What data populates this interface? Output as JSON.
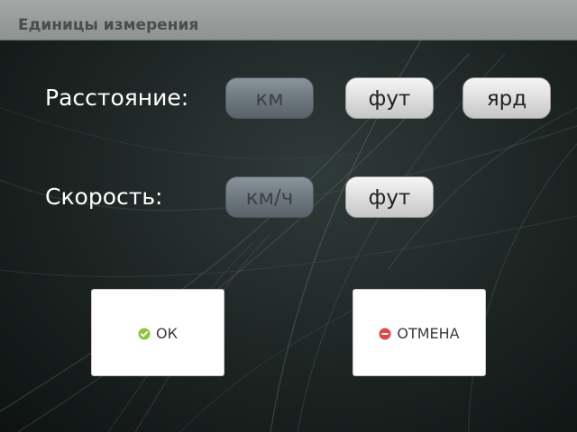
{
  "window": {
    "title": "Единицы измерения"
  },
  "distance": {
    "label": "Расстояние:",
    "options": [
      {
        "label": "км",
        "selected": false
      },
      {
        "label": "фут",
        "selected": true
      },
      {
        "label": "ярд",
        "selected": true
      }
    ]
  },
  "speed": {
    "label": "Скорость:",
    "options": [
      {
        "label": "км/ч",
        "selected": false
      },
      {
        "label": "фут",
        "selected": true
      }
    ]
  },
  "actions": {
    "ok_label": "ОК",
    "cancel_label": "ОТМЕНА"
  },
  "icons": {
    "ok": "check-circle-icon",
    "cancel": "minus-circle-icon"
  },
  "colors": {
    "ok_icon": "#8cc63f",
    "cancel_icon": "#e04848",
    "title_bar": "#9a9e9d"
  }
}
